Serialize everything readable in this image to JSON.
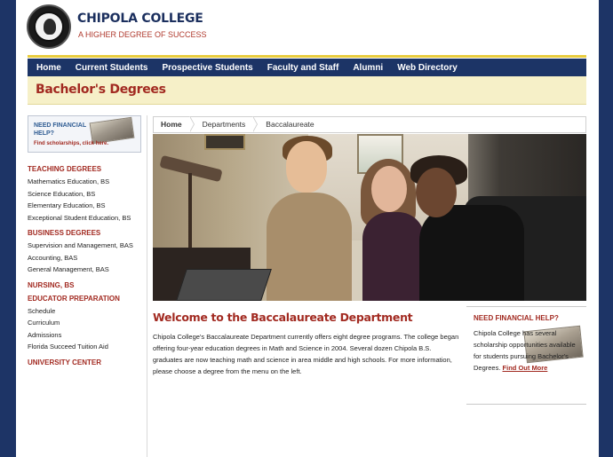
{
  "header": {
    "college_name": "CHIPOLA COLLEGE",
    "tagline": "A HIGHER DEGREE OF SUCCESS",
    "seal_icon": "college-seal"
  },
  "nav": {
    "items": [
      {
        "label": "Home"
      },
      {
        "label": "Current Students"
      },
      {
        "label": "Prospective Students"
      },
      {
        "label": "Faculty and Staff"
      },
      {
        "label": "Alumni"
      },
      {
        "label": "Web Directory"
      }
    ]
  },
  "page_title": "Bachelor's Degrees",
  "sidebar": {
    "aid_box": {
      "title": "NEED FINANCIAL HELP?",
      "link": "Find scholarships, click here."
    },
    "sections": [
      {
        "heading": "TEACHING DEGREES",
        "links": [
          "Mathematics Education, BS",
          "Science Education, BS",
          "Elementary Education, BS",
          "Exceptional Student Education, BS"
        ]
      },
      {
        "heading": "BUSINESS DEGREES",
        "links": [
          "Supervision and Management, BAS",
          "Accounting, BAS",
          "General Management, BAS"
        ]
      },
      {
        "heading": "NURSING, BS",
        "links": []
      },
      {
        "heading": "EDUCATOR PREPARATION",
        "links": [
          "Schedule",
          "Curriculum",
          "Admissions",
          "Florida Succeed Tuition Aid"
        ]
      },
      {
        "heading": "UNIVERSITY CENTER",
        "links": []
      }
    ]
  },
  "breadcrumb": [
    "Home",
    "Departments",
    "Baccalaureate"
  ],
  "main": {
    "title": "Welcome to the Baccalaureate Department",
    "body": "Chipola College's Baccalaureate Department currently offers eight degree programs. The college began offering four-year education degrees in Math and Science in 2004. Several dozen Chipola B.S. graduates are now teaching math and science in area middle and high schools. For more information, please choose a degree from the menu on the left."
  },
  "right_box": {
    "title": "NEED FINANCIAL HELP?",
    "text": "Chipola College has several scholarship opportunities available for students pursuing Bachelor's Degrees.",
    "link": "Find Out More"
  },
  "colors": {
    "navy": "#1c3466",
    "accent_red": "#a22a21",
    "gold": "#e9cc3d",
    "title_bar": "#f6f0c8"
  }
}
